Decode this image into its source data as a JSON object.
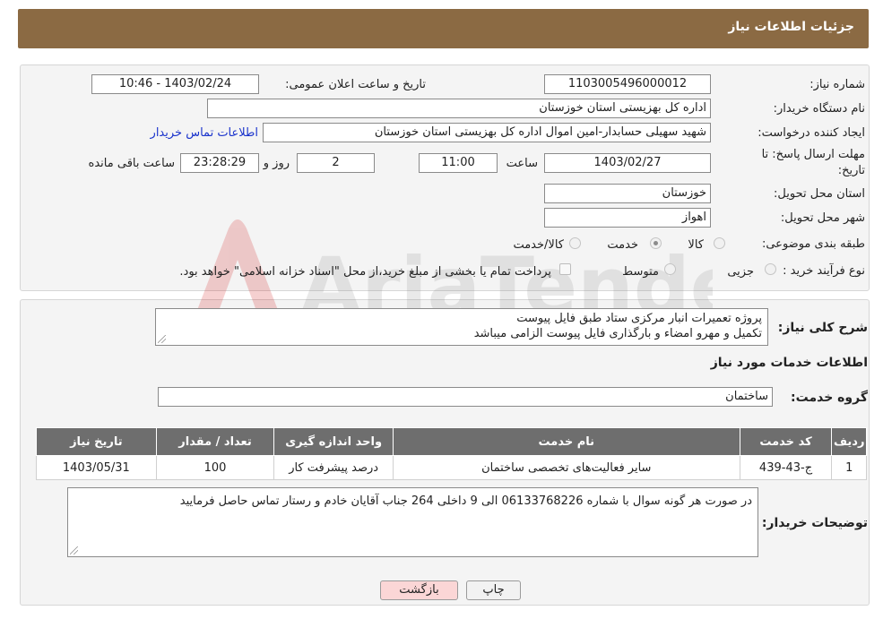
{
  "header": {
    "title": "جزئیات اطلاعات نیاز"
  },
  "form": {
    "need_number": {
      "label": "شماره نیاز:",
      "value": "1103005496000012"
    },
    "announce_datetime": {
      "label": "تاریخ و ساعت اعلان عمومی:",
      "value": "1403/02/24 - 10:46"
    },
    "buyer_org": {
      "label": "نام دستگاه خریدار:",
      "value": "اداره کل بهزیستی استان خوزستان"
    },
    "requester": {
      "label": "ایجاد کننده درخواست:",
      "value": "شهید سهیلی حسابدار-امین اموال اداره کل بهزیستی استان خوزستان"
    },
    "buyer_contact_link": "اطلاعات تماس خریدار",
    "deadline": {
      "label_line1": "مهلت ارسال پاسخ: تا",
      "label_line2": "تاریخ:",
      "date": "1403/02/27",
      "time_label": "ساعت",
      "time": "11:00",
      "days": "2",
      "days_label": "روز و",
      "remaining": "23:28:29",
      "remaining_label": "ساعت باقی مانده"
    },
    "province": {
      "label": "استان محل تحویل:",
      "value": "خوزستان"
    },
    "city": {
      "label": "شهر محل تحویل:",
      "value": "اهواز"
    },
    "category": {
      "label": "طبقه بندی موضوعی:",
      "options": [
        "کالا",
        "خدمت",
        "کالا/خدمت"
      ],
      "selected": "خدمت"
    },
    "purchase_process": {
      "label": "نوع فرآیند خرید :",
      "options": [
        "جزیی",
        "متوسط"
      ],
      "selected": "",
      "payment_note": "پرداخت تمام یا بخشی از مبلغ خرید،از محل \"اسناد خزانه اسلامی\" خواهد بود."
    }
  },
  "details": {
    "summary_label": "شرح کلی نیاز:",
    "summary_lines": [
      "پروژه تعمیرات انبار مرکزی ستاد طبق فایل پیوست",
      "تکمیل و مهرو امضاء و بارگذاری فایل پیوست الزامی میباشد"
    ],
    "services_title": "اطلاعات خدمات مورد نیاز",
    "service_group_label": "گروه خدمت:",
    "service_group_value": "ساختمان",
    "table": {
      "headers": [
        "ردیف",
        "کد خدمت",
        "نام خدمت",
        "واحد اندازه گیری",
        "تعداد / مقدار",
        "تاریخ نیاز"
      ],
      "rows": [
        [
          "1",
          "ج-43-439",
          "سایر فعالیت‌های تخصصی ساختمان",
          "درصد پیشرفت کار",
          "100",
          "1403/05/31"
        ]
      ]
    },
    "buyer_notes_label": "توضیحات خریدار:",
    "buyer_notes": "در صورت هر گونه سوال با شماره 06133768226 الی 9 داخلی 264 جناب آقایان خادم  و  رستار تماس حاصل فرمایید"
  },
  "buttons": {
    "print": "چاپ",
    "back": "بازگشت"
  },
  "watermark": {
    "text": "AriaTender.neT"
  }
}
